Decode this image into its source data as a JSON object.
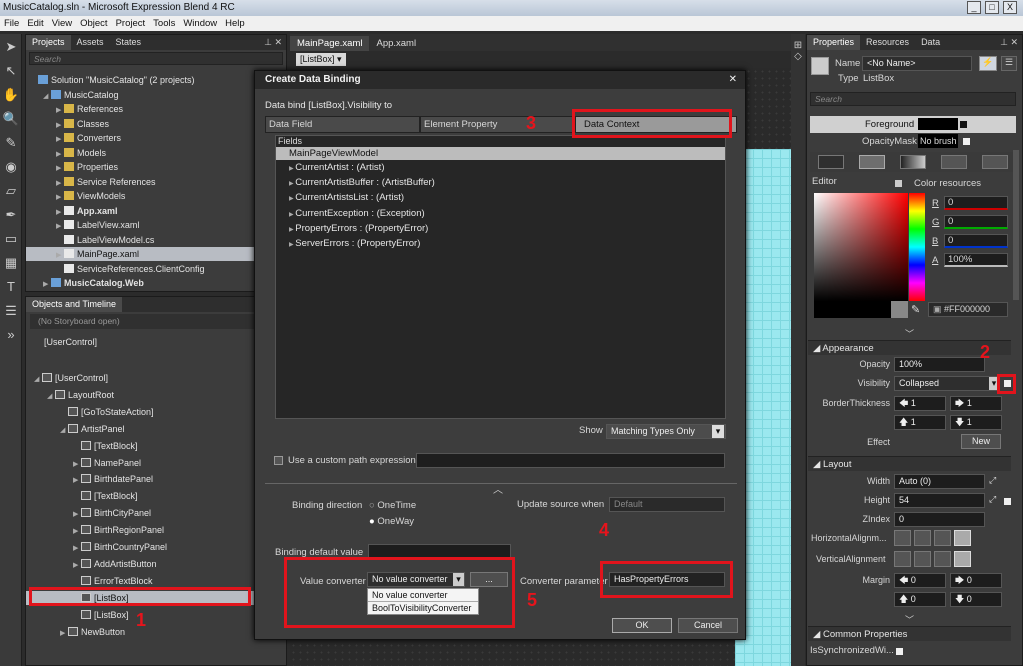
{
  "window": {
    "title": "MusicCatalog.sln - Microsoft Expression Blend 4 RC",
    "buttons": [
      "_",
      "□",
      "X"
    ]
  },
  "menu": [
    "File",
    "Edit",
    "View",
    "Object",
    "Project",
    "Tools",
    "Window",
    "Help"
  ],
  "projects_panel": {
    "tabs": [
      "Projects",
      "Assets",
      "States"
    ],
    "search_placeholder": "Search",
    "tree": [
      {
        "label": "Solution \"MusicCatalog\" (2 projects)",
        "indent": 0,
        "arrow": "",
        "icon": "proj"
      },
      {
        "label": "MusicCatalog",
        "indent": 1,
        "arrow": "◢",
        "icon": "proj"
      },
      {
        "label": "References",
        "indent": 2,
        "arrow": "▶",
        "icon": "folder"
      },
      {
        "label": "Classes",
        "indent": 2,
        "arrow": "▶",
        "icon": "folder"
      },
      {
        "label": "Converters",
        "indent": 2,
        "arrow": "▶",
        "icon": "folder"
      },
      {
        "label": "Models",
        "indent": 2,
        "arrow": "▶",
        "icon": "folder"
      },
      {
        "label": "Properties",
        "indent": 2,
        "arrow": "▶",
        "icon": "folder"
      },
      {
        "label": "Service References",
        "indent": 2,
        "arrow": "▶",
        "icon": "folder"
      },
      {
        "label": "ViewModels",
        "indent": 2,
        "arrow": "▶",
        "icon": "folder"
      },
      {
        "label": "App.xaml",
        "indent": 2,
        "arrow": "▶",
        "icon": "file",
        "bold": true
      },
      {
        "label": "LabelView.xaml",
        "indent": 2,
        "arrow": "▶",
        "icon": "file"
      },
      {
        "label": "LabelViewModel.cs",
        "indent": 2,
        "arrow": "",
        "icon": "file"
      },
      {
        "label": "MainPage.xaml",
        "indent": 2,
        "arrow": "▶",
        "icon": "file",
        "selected": true
      },
      {
        "label": "ServiceReferences.ClientConfig",
        "indent": 2,
        "arrow": "",
        "icon": "file"
      },
      {
        "label": "MusicCatalog.Web",
        "indent": 1,
        "arrow": "▶",
        "icon": "proj",
        "bold": true
      }
    ]
  },
  "objects_panel": {
    "title": "Objects and Timeline",
    "storyboard": "(No Storyboard open)",
    "root": "[UserControl]",
    "tree": [
      {
        "label": "[UserControl]",
        "indent": 0,
        "arrow": "◢",
        "icon": "ctrl"
      },
      {
        "label": "LayoutRoot",
        "indent": 1,
        "arrow": "◢",
        "icon": "ctrl"
      },
      {
        "label": "[GoToStateAction]",
        "indent": 2,
        "arrow": "",
        "icon": "ctrl"
      },
      {
        "label": "ArtistPanel",
        "indent": 2,
        "arrow": "◢",
        "icon": "ctrl"
      },
      {
        "label": "[TextBlock]",
        "indent": 3,
        "arrow": "",
        "icon": "ctrl"
      },
      {
        "label": "NamePanel",
        "indent": 3,
        "arrow": "▶",
        "icon": "ctrl"
      },
      {
        "label": "BirthdatePanel",
        "indent": 3,
        "arrow": "▶",
        "icon": "ctrl"
      },
      {
        "label": "[TextBlock]",
        "indent": 3,
        "arrow": "",
        "icon": "ctrl"
      },
      {
        "label": "BirthCityPanel",
        "indent": 3,
        "arrow": "▶",
        "icon": "ctrl"
      },
      {
        "label": "BirthRegionPanel",
        "indent": 3,
        "arrow": "▶",
        "icon": "ctrl"
      },
      {
        "label": "BirthCountryPanel",
        "indent": 3,
        "arrow": "▶",
        "icon": "ctrl"
      },
      {
        "label": "AddArtistButton",
        "indent": 3,
        "arrow": "▶",
        "icon": "ctrl"
      },
      {
        "label": "ErrorTextBlock",
        "indent": 3,
        "arrow": "",
        "icon": "ctrl"
      },
      {
        "label": "[ListBox]",
        "indent": 3,
        "arrow": "",
        "icon": "ctrl",
        "selected": true
      },
      {
        "label": "[ListBox]",
        "indent": 3,
        "arrow": "",
        "icon": "ctrl"
      },
      {
        "label": "NewButton",
        "indent": 2,
        "arrow": "▶",
        "icon": "ctrl"
      }
    ]
  },
  "documents": {
    "tabs": [
      "MainPage.xaml",
      "App.xaml"
    ],
    "breadcrumb": "[ListBox]"
  },
  "dialog": {
    "title": "Create Data Binding",
    "subtitle": "Data bind [ListBox].Visibility to",
    "tabs": [
      "Data Field",
      "Element Property",
      "Data Context"
    ],
    "fields_label": "Fields",
    "fields_root": "MainPageViewModel",
    "fields": [
      "CurrentArtist : (Artist)",
      "CurrentArtistBuffer : (ArtistBuffer)",
      "CurrentArtistsList : (Artist)",
      "CurrentException : (Exception)",
      "PropertyErrors : (PropertyError)",
      "ServerErrors : (PropertyError)"
    ],
    "show_label": "Show",
    "show_value": "Matching Types Only",
    "custom_path_label": "Use a custom path expression",
    "binding_direction_label": "Binding direction",
    "direction_options": [
      "OneTime",
      "OneWay"
    ],
    "update_source_label": "Update source when",
    "update_source_value": "Default",
    "binding_default_label": "Binding default value",
    "value_converter_label": "Value converter",
    "value_converter_value": "No value converter",
    "converter_options": [
      "No value converter",
      "BoolToVisibilityConverter"
    ],
    "ellipsis": "...",
    "converter_param_label": "Converter parameter",
    "converter_param_value": "HasPropertyErrors",
    "ok": "OK",
    "cancel": "Cancel",
    "close": "✕"
  },
  "properties_panel": {
    "tabs": [
      "Properties",
      "Resources",
      "Data"
    ],
    "name_label": "Name",
    "name_value": "<No Name>",
    "type_label": "Type",
    "type_value": "ListBox",
    "search_placeholder": "Search",
    "foreground_label": "Foreground",
    "opacitymask_label": "OpacityMask",
    "opacitymask_value": "No brush",
    "editor_tab": "Editor",
    "color_resources_tab": "Color resources",
    "channels": [
      {
        "label": "R",
        "value": "0"
      },
      {
        "label": "G",
        "value": "0"
      },
      {
        "label": "B",
        "value": "0"
      },
      {
        "label": "A",
        "value": "100%"
      }
    ],
    "hex": "#FF000000",
    "appearance": {
      "title": "Appearance",
      "opacity_label": "Opacity",
      "opacity_value": "100%",
      "visibility_label": "Visibility",
      "visibility_value": "Collapsed",
      "border_label": "BorderThickness",
      "border_values": [
        "1",
        "1",
        "1",
        "1"
      ],
      "effect_label": "Effect",
      "new_button": "New"
    },
    "layout": {
      "title": "Layout",
      "width_label": "Width",
      "width_value": "Auto (0)",
      "height_label": "Height",
      "height_value": "54",
      "zindex_label": "ZIndex",
      "zindex_value": "0",
      "halign_label": "HorizontalAlignm...",
      "valign_label": "VerticalAlignment",
      "margin_label": "Margin",
      "margin_values": [
        "0",
        "0",
        "0",
        "0"
      ]
    },
    "common": {
      "title": "Common Properties",
      "sync_label": "IsSynchronizedWi..."
    }
  },
  "annotations": [
    "1",
    "2",
    "3",
    "4",
    "5"
  ],
  "colors": {
    "annotation_red": "#e1141c",
    "canvas_cyan": "#9be8ef",
    "selection": "#b8bcc3"
  }
}
